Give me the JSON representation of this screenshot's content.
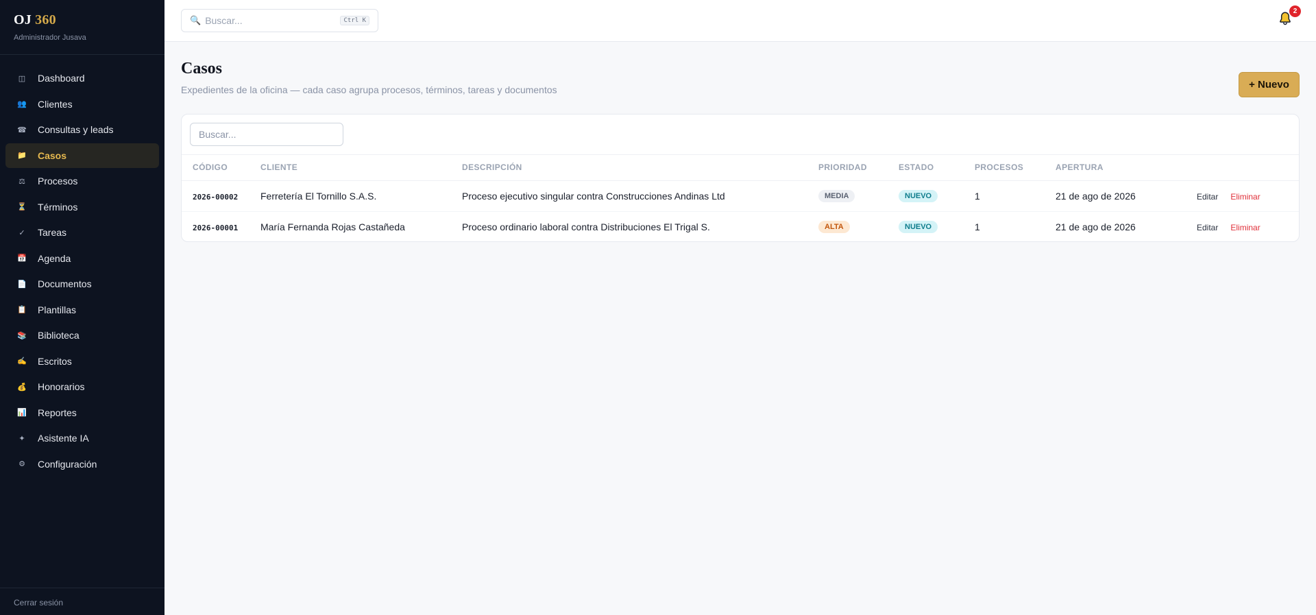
{
  "brand": {
    "name": "OJ",
    "number": "360",
    "subtitle": "Administrador Jusava"
  },
  "sidebar": {
    "items": [
      {
        "label": "Dashboard",
        "icon": "◫",
        "name": "dashboard"
      },
      {
        "label": "Clientes",
        "icon": "👥",
        "name": "clientes"
      },
      {
        "label": "Consultas y leads",
        "icon": "☎",
        "name": "consultas"
      },
      {
        "label": "Casos",
        "icon": "📁",
        "name": "casos",
        "active": true
      },
      {
        "label": "Procesos",
        "icon": "⚖",
        "name": "procesos"
      },
      {
        "label": "Términos",
        "icon": "⏳",
        "name": "terminos"
      },
      {
        "label": "Tareas",
        "icon": "✓",
        "name": "tareas"
      },
      {
        "label": "Agenda",
        "icon": "📅",
        "name": "agenda"
      },
      {
        "label": "Documentos",
        "icon": "📄",
        "name": "documentos"
      },
      {
        "label": "Plantillas",
        "icon": "📋",
        "name": "plantillas"
      },
      {
        "label": "Biblioteca",
        "icon": "📚",
        "name": "biblioteca"
      },
      {
        "label": "Escritos",
        "icon": "✍",
        "name": "escritos"
      },
      {
        "label": "Honorarios",
        "icon": "💰",
        "name": "honorarios"
      },
      {
        "label": "Reportes",
        "icon": "📊",
        "name": "reportes"
      },
      {
        "label": "Asistente IA",
        "icon": "✦",
        "name": "asistente-ia"
      },
      {
        "label": "Configuración",
        "icon": "⚙",
        "name": "configuracion"
      }
    ],
    "logout": "Cerrar sesión"
  },
  "topbar": {
    "search_placeholder": "Buscar...",
    "shortcut": "Ctrl K",
    "notifications": "2"
  },
  "page": {
    "title": "Casos",
    "subtitle": "Expedientes de la oficina — cada caso agrupa procesos, términos, tareas y documentos",
    "new_button": "+ Nuevo",
    "filter_placeholder": "Buscar..."
  },
  "table": {
    "columns": [
      "CÓDIGO",
      "CLIENTE",
      "DESCRIPCIÓN",
      "PRIORIDAD",
      "ESTADO",
      "PROCESOS",
      "APERTURA"
    ],
    "rows": [
      {
        "code": "2026-00002",
        "client": "Ferretería El Tornillo S.A.S.",
        "description": "Proceso ejecutivo singular contra Construcciones Andinas Ltd",
        "priority": "MEDIA",
        "status": "NUEVO",
        "processes": "1",
        "opened": "21 de ago de 2026"
      },
      {
        "code": "2026-00001",
        "client": "María Fernanda Rojas Castañeda",
        "description": "Proceso ordinario laboral contra Distribuciones El Trigal S.",
        "priority": "ALTA",
        "status": "NUEVO",
        "processes": "1",
        "opened": "21 de ago de 2026"
      }
    ],
    "actions": {
      "edit": "Editar",
      "delete": "Eliminar"
    }
  },
  "colors": {
    "sidebar_bg": "#0d1320",
    "accent": "#d9ac55",
    "active_text": "#e7b94f",
    "danger": "#e0303a"
  }
}
